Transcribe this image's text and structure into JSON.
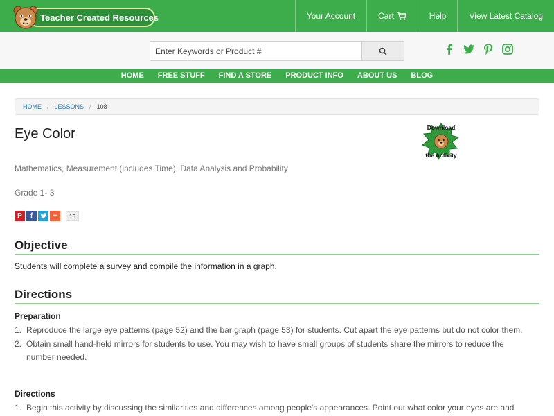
{
  "header": {
    "logo_text": "Teacher Created Resources",
    "nav": [
      {
        "label": "Your Account"
      },
      {
        "label": "Cart"
      },
      {
        "label": "Help"
      },
      {
        "label": "View Latest Catalog"
      }
    ]
  },
  "search": {
    "placeholder": "Enter Keywords or Product #",
    "value": ""
  },
  "social_icons": [
    "facebook-icon",
    "twitter-icon",
    "pinterest-icon",
    "instagram-icon"
  ],
  "main_nav": [
    "HOME",
    "FREE STUFF",
    "FIND A STORE",
    "PRODUCT INFO",
    "ABOUT US",
    "BLOG"
  ],
  "breadcrumb": {
    "items": [
      "HOME",
      "LESSONS"
    ],
    "current": "108"
  },
  "lesson": {
    "title": "Eye Color",
    "subjects": "Mathematics, Measurement (includes Time), Data Analysis and Probability",
    "grade": "Grade 1- 3",
    "share_count": "16",
    "download_line1": "Download",
    "download_line2": "the Activity"
  },
  "objective": {
    "heading": "Objective",
    "text": "Students will complete a survey and compile the information in a graph."
  },
  "directions": {
    "heading": "Directions",
    "preparation_heading": "Preparation",
    "preparation_steps": [
      {
        "num": "1.",
        "text": "Reproduce the large eye patterns (page 52) and the bar graph (page 53) for students. Cut apart the eye patterns but do not color them."
      },
      {
        "num": "2.",
        "text": "Obtain small hand-held mirrors for students to use. You may wish to have small groups of students share the mirrors to reduce the number needed."
      }
    ],
    "directions_heading": "Directions",
    "direction_steps": [
      {
        "num": "1.",
        "text": "Begin this activity by discussing the similarities and differences among people's appearances. Point out what color your eyes are and"
      }
    ]
  },
  "colors": {
    "brand_green": "#3dac4a",
    "link_blue": "#2a7bb6"
  }
}
